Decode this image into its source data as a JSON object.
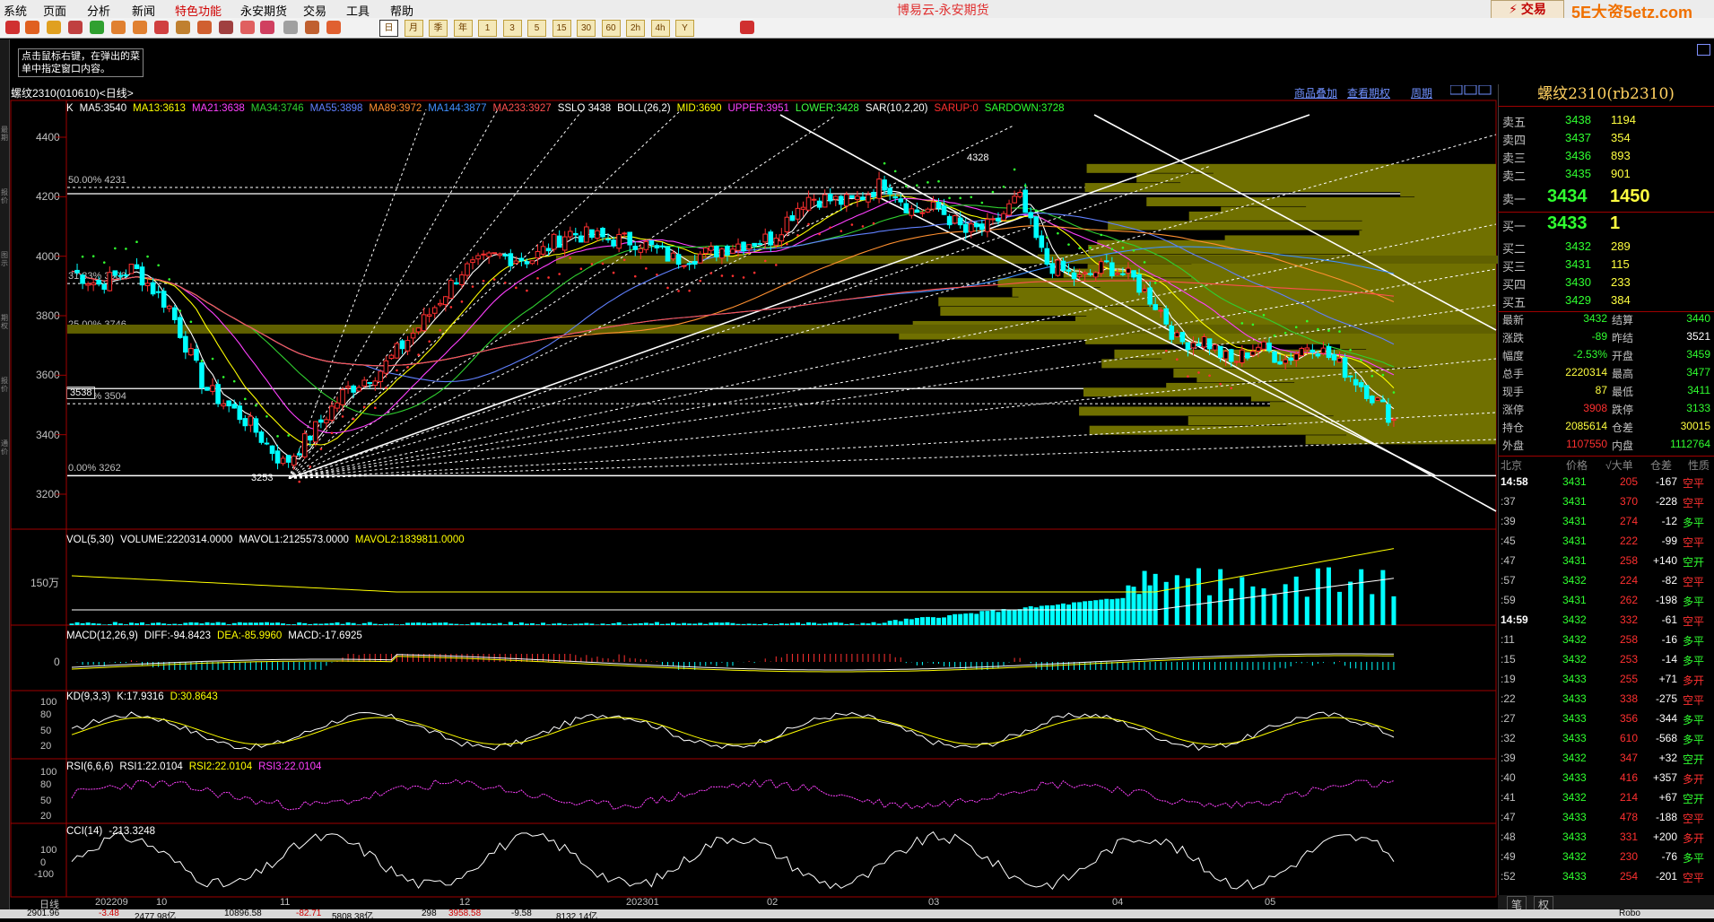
{
  "menu": {
    "items": [
      "系统",
      "页面",
      "分析",
      "新闻",
      "特色功能",
      "永安期货",
      "交易",
      "工具",
      "帮助"
    ],
    "app_title": "博易云-永安期货",
    "trade_button": "交易",
    "watermark": "5E大资5etz.com"
  },
  "toolbar": {
    "period_buttons": [
      "日",
      "月",
      "季",
      "年",
      "1",
      "3",
      "5",
      "15",
      "30",
      "60",
      "2h",
      "4h",
      "Y"
    ],
    "selected_period": "日"
  },
  "hint": "点击鼠标右键，在弹出的菜单中指定窗口内容。",
  "left_strip_labels": [
    "最期",
    "报价",
    "图示",
    "期权",
    "报价",
    "通价"
  ],
  "chart": {
    "symbol_line": "螺纹2310(010610)<日线>",
    "top_links": [
      "商品叠加",
      "查看期权",
      "周期"
    ],
    "indicator_line": [
      {
        "text": "K",
        "color": "#ffffff"
      },
      {
        "text": "MA5:3540",
        "color": "#ffffff"
      },
      {
        "text": "MA13:3613",
        "color": "#ffff00"
      },
      {
        "text": "MA21:3638",
        "color": "#ff40ff"
      },
      {
        "text": "MA34:3746",
        "color": "#30d030"
      },
      {
        "text": "MA55:3898",
        "color": "#6080ff"
      },
      {
        "text": "MA89:3972",
        "color": "#ff9030"
      },
      {
        "text": "MA144:3877",
        "color": "#4090ff"
      },
      {
        "text": "MA233:3927",
        "color": "#ff5050"
      },
      {
        "text": "SSLO 3438",
        "color": "#ffffff"
      },
      {
        "text": "BOLL(26,2)",
        "color": "#ffffff"
      },
      {
        "text": "MID:3690",
        "color": "#ffff00"
      },
      {
        "text": "UPPER:3951",
        "color": "#ff40ff"
      },
      {
        "text": "LOWER:3428",
        "color": "#40ff40"
      },
      {
        "text": "SAR(10,2,20)",
        "color": "#ffffff"
      },
      {
        "text": "SARUP:0",
        "color": "#ff3030"
      },
      {
        "text": "SARDOWN:3728",
        "color": "#30ff30"
      }
    ],
    "price_ticks": [
      "4400",
      "4200",
      "4000",
      "3800",
      "3600",
      "3400",
      "3200"
    ],
    "fib_labels": [
      "50.00%  4231",
      "31.33%  3908",
      "25.00%  3746",
      "12.50%  3504",
      "0.00%  3262"
    ],
    "current_price_box": "3538",
    "high_label": "4328",
    "low_label": "3253",
    "volume_line": [
      {
        "text": "VOL(5,30)",
        "color": "#ffffff"
      },
      {
        "text": "VOLUME:2220314.0000",
        "color": "#ffffff"
      },
      {
        "text": "MAVOL1:2125573.0000",
        "color": "#ffffff"
      },
      {
        "text": "MAVOL2:1839811.0000",
        "color": "#ffff00"
      }
    ],
    "volume_tick": "150万",
    "macd_line": [
      {
        "text": "MACD(12,26,9)",
        "color": "#ffffff"
      },
      {
        "text": "DIFF:-94.8423",
        "color": "#ffffff"
      },
      {
        "text": "DEA:-85.9960",
        "color": "#ffff00"
      },
      {
        "text": "MACD:-17.6925",
        "color": "#ffffff"
      }
    ],
    "macd_tick": "0",
    "kd_line": [
      {
        "text": "KD(9,3,3)",
        "color": "#ffffff"
      },
      {
        "text": "K:17.9316",
        "color": "#ffffff"
      },
      {
        "text": "D:30.8643",
        "color": "#ffff00"
      }
    ],
    "kd_ticks": [
      "100",
      "80",
      "50",
      "20"
    ],
    "rsi_line": [
      {
        "text": "RSI(6,6,6)",
        "color": "#ffffff"
      },
      {
        "text": "RSI1:22.0104",
        "color": "#ffffff"
      },
      {
        "text": "RSI2:22.0104",
        "color": "#ffff00"
      },
      {
        "text": "RSI3:22.0104",
        "color": "#ff40ff"
      }
    ],
    "rsi_ticks": [
      "100",
      "80",
      "50",
      "20"
    ],
    "cci_line": [
      {
        "text": "CCI(14)",
        "color": "#ffffff"
      },
      {
        "text": "-213.3248",
        "color": "#ffffff"
      }
    ],
    "cci_ticks": [
      "100",
      "0",
      "-100"
    ],
    "date_axis": [
      "日线",
      "202209",
      "10",
      "11",
      "12",
      "202301",
      "02",
      "03",
      "04",
      "05"
    ]
  },
  "quote_panel": {
    "title": "螺纹2310(rb2310)",
    "asks": [
      {
        "label": "卖五",
        "price": "3438",
        "vol": "1194"
      },
      {
        "label": "卖四",
        "price": "3437",
        "vol": "354"
      },
      {
        "label": "卖三",
        "price": "3436",
        "vol": "893"
      },
      {
        "label": "卖二",
        "price": "3435",
        "vol": "901"
      },
      {
        "label": "卖一",
        "price": "3434",
        "vol": "1450"
      }
    ],
    "bids": [
      {
        "label": "买一",
        "price": "3433",
        "vol": "1"
      },
      {
        "label": "买二",
        "price": "3432",
        "vol": "289"
      },
      {
        "label": "买三",
        "price": "3431",
        "vol": "115"
      },
      {
        "label": "买四",
        "price": "3430",
        "vol": "233"
      },
      {
        "label": "买五",
        "price": "3429",
        "vol": "384"
      }
    ],
    "stats": [
      {
        "l1": "最新",
        "v1": "3432",
        "c1": "#30ff30",
        "l2": "结算",
        "v2": "3440",
        "c2": "#30ff30"
      },
      {
        "l1": "涨跌",
        "v1": "-89",
        "c1": "#30ff30",
        "l2": "昨结",
        "v2": "3521",
        "c2": "#ffffff"
      },
      {
        "l1": "幅度",
        "v1": "-2.53%",
        "c1": "#30ff30",
        "l2": "开盘",
        "v2": "3459",
        "c2": "#30ff30"
      },
      {
        "l1": "总手",
        "v1": "2220314",
        "c1": "#ffff40",
        "l2": "最高",
        "v2": "3477",
        "c2": "#30ff30"
      },
      {
        "l1": "现手",
        "v1": "87",
        "c1": "#ffff40",
        "l2": "最低",
        "v2": "3411",
        "c2": "#30ff30"
      },
      {
        "l1": "涨停",
        "v1": "3908",
        "c1": "#ff3030",
        "l2": "跌停",
        "v2": "3133",
        "c2": "#30ff30"
      },
      {
        "l1": "持仓",
        "v1": "2085614",
        "c1": "#ffff40",
        "l2": "仓差",
        "v2": "30015",
        "c2": "#ffff40"
      },
      {
        "l1": "外盘",
        "v1": "1107550",
        "c1": "#ff3030",
        "l2": "内盘",
        "v2": "1112764",
        "c2": "#30ff30"
      }
    ],
    "tick_header": [
      "北京",
      "价格",
      "√大单",
      "仓差",
      "性质"
    ],
    "ticks": [
      {
        "time": "14:58",
        "price": "3431",
        "vol": "205",
        "diff": "-167",
        "nature": "空平",
        "tc": "#ffffff",
        "nc": "#ff3030"
      },
      {
        "time": ":37",
        "price": "3431",
        "vol": "370",
        "diff": "-228",
        "nature": "空平",
        "tc": "#c0c0c0",
        "nc": "#ff3030"
      },
      {
        "time": ":39",
        "price": "3431",
        "vol": "274",
        "diff": "-12",
        "nature": "多平",
        "tc": "#c0c0c0",
        "nc": "#30ff30"
      },
      {
        "time": ":45",
        "price": "3431",
        "vol": "222",
        "diff": "-99",
        "nature": "空平",
        "tc": "#c0c0c0",
        "nc": "#ff3030"
      },
      {
        "time": ":47",
        "price": "3431",
        "vol": "258",
        "diff": "+140",
        "nature": "空开",
        "tc": "#c0c0c0",
        "nc": "#30ff30"
      },
      {
        "time": ":57",
        "price": "3432",
        "vol": "224",
        "diff": "-82",
        "nature": "空平",
        "tc": "#c0c0c0",
        "nc": "#ff3030"
      },
      {
        "time": ":59",
        "price": "3431",
        "vol": "262",
        "diff": "-198",
        "nature": "多平",
        "tc": "#c0c0c0",
        "nc": "#30ff30"
      },
      {
        "time": "14:59",
        "price": "3432",
        "vol": "332",
        "diff": "-61",
        "nature": "空平",
        "tc": "#ffffff",
        "nc": "#ff3030"
      },
      {
        "time": ":11",
        "price": "3432",
        "vol": "258",
        "diff": "-16",
        "nature": "多平",
        "tc": "#c0c0c0",
        "nc": "#30ff30"
      },
      {
        "time": ":15",
        "price": "3432",
        "vol": "253",
        "diff": "-14",
        "nature": "多平",
        "tc": "#c0c0c0",
        "nc": "#30ff30"
      },
      {
        "time": ":19",
        "price": "3433",
        "vol": "255",
        "diff": "+71",
        "nature": "多开",
        "tc": "#c0c0c0",
        "nc": "#ff3030"
      },
      {
        "time": ":22",
        "price": "3433",
        "vol": "338",
        "diff": "-275",
        "nature": "空平",
        "tc": "#c0c0c0",
        "nc": "#ff3030"
      },
      {
        "time": ":27",
        "price": "3433",
        "vol": "356",
        "diff": "-344",
        "nature": "多平",
        "tc": "#c0c0c0",
        "nc": "#30ff30"
      },
      {
        "time": ":32",
        "price": "3433",
        "vol": "610",
        "diff": "-568",
        "nature": "多平",
        "tc": "#c0c0c0",
        "nc": "#30ff30"
      },
      {
        "time": ":39",
        "price": "3432",
        "vol": "347",
        "diff": "+32",
        "nature": "空开",
        "tc": "#c0c0c0",
        "nc": "#30ff30"
      },
      {
        "time": ":40",
        "price": "3433",
        "vol": "416",
        "diff": "+357",
        "nature": "多开",
        "tc": "#c0c0c0",
        "nc": "#ff3030"
      },
      {
        "time": ":41",
        "price": "3432",
        "vol": "214",
        "diff": "+67",
        "nature": "空开",
        "tc": "#c0c0c0",
        "nc": "#30ff30"
      },
      {
        "time": ":47",
        "price": "3433",
        "vol": "478",
        "diff": "-188",
        "nature": "空平",
        "tc": "#c0c0c0",
        "nc": "#ff3030"
      },
      {
        "time": ":48",
        "price": "3433",
        "vol": "331",
        "diff": "+200",
        "nature": "多开",
        "tc": "#c0c0c0",
        "nc": "#ff3030"
      },
      {
        "time": ":49",
        "price": "3432",
        "vol": "230",
        "diff": "-76",
        "nature": "多平",
        "tc": "#c0c0c0",
        "nc": "#30ff30"
      },
      {
        "time": ":52",
        "price": "3433",
        "vol": "254",
        "diff": "-201",
        "nature": "空平",
        "tc": "#c0c0c0",
        "nc": "#ff3030"
      }
    ],
    "bottom_tabs": [
      "笔",
      "权"
    ]
  },
  "status": {
    "segments": [
      "2901.96",
      "-3.48",
      "2477.98亿",
      "10896.58",
      "-82.71",
      "5808.38亿",
      "298",
      "3958.58",
      "-9.58",
      "8132.14亿"
    ],
    "right": "Robo"
  }
}
